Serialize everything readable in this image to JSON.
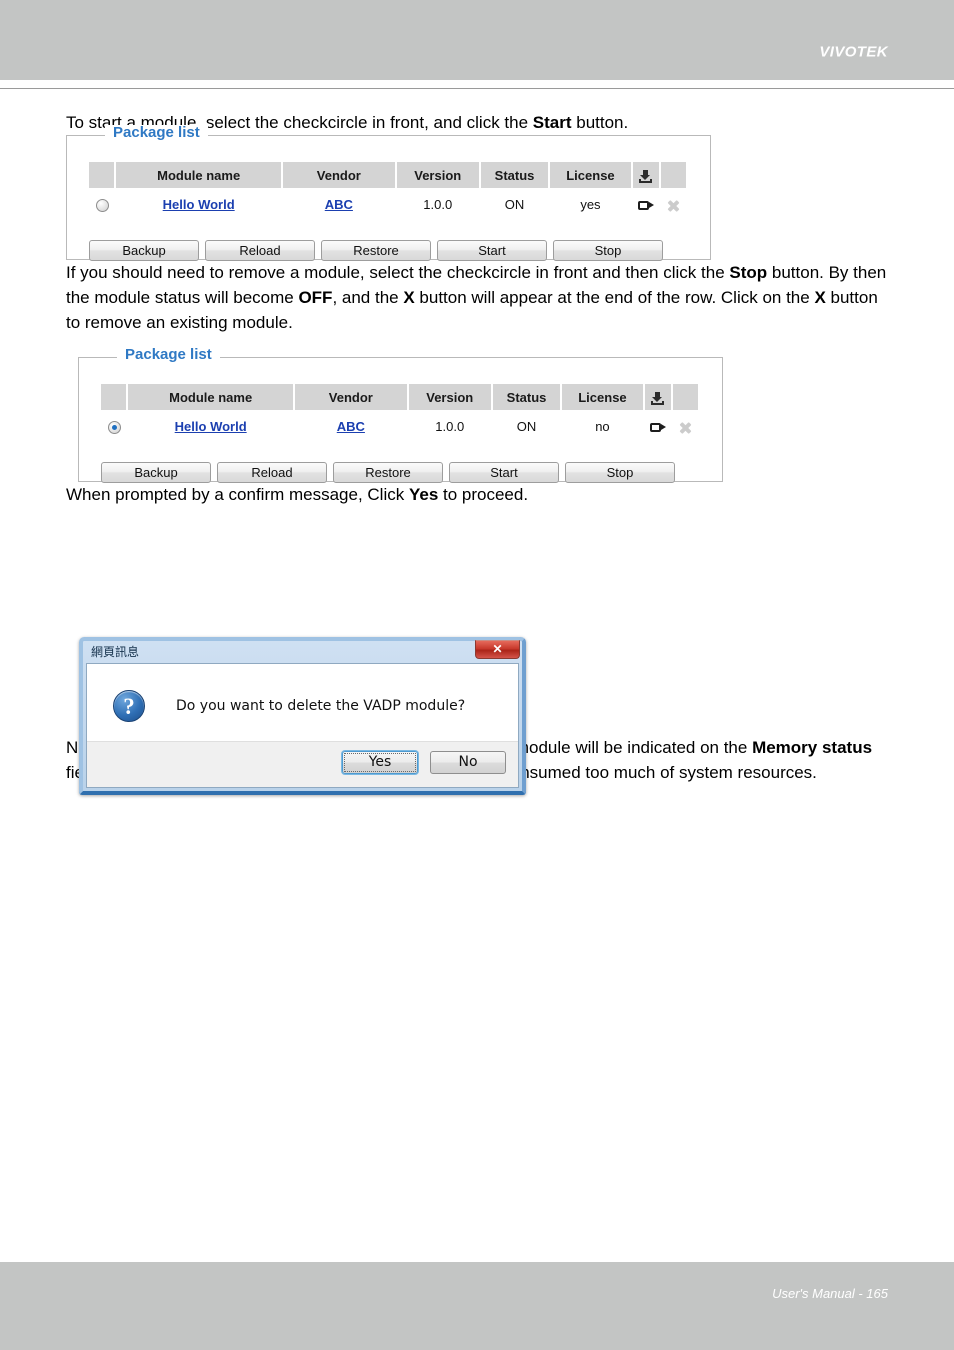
{
  "header": {
    "brand": "VIVOTEK"
  },
  "footer": {
    "text": "User's Manual - 165"
  },
  "paragraphs": {
    "p1_a": "To start a module, select the checkcircle in front, and click the ",
    "p1_b": "Start",
    "p1_c": " button.",
    "p2_a": "If you should need to remove a module, select the checkcircle in front and then click the ",
    "p2_b": "Stop",
    "p2_c": " button. By then the module status will become ",
    "p2_d": "OFF",
    "p2_e": ", and the ",
    "p2_f": "X",
    "p2_g": " button will appear at the end of the row. Click on the ",
    "p2_h": "X",
    "p2_i": " button to remove an existing module.",
    "p3_a": "When prompted by a confirm message, Click ",
    "p3_b": "Yes",
    "p3_c": " to proceed.",
    "p4_a": "Note that the actual memory consumed while operating the module will be indicated on the ",
    "p4_b": "Memory status",
    "p4_c": " field. This helps determine whether a running module has consumed too much of system resources."
  },
  "package_list_1": {
    "legend": "Package list",
    "columns": [
      "",
      "Module name",
      "Vendor",
      "Version",
      "Status",
      "License",
      "download-icon",
      ""
    ],
    "row": {
      "selected": false,
      "module_name": "Hello World",
      "vendor": "ABC",
      "version": "1.0.0",
      "status": "ON",
      "license": "yes"
    },
    "buttons": [
      "Backup",
      "Reload",
      "Restore",
      "Start",
      "Stop"
    ]
  },
  "package_list_2": {
    "legend": "Package list",
    "columns": [
      "",
      "Module name",
      "Vendor",
      "Version",
      "Status",
      "License",
      "download-icon",
      ""
    ],
    "row": {
      "selected": true,
      "module_name": "Hello World",
      "vendor": "ABC",
      "version": "1.0.0",
      "status": "ON",
      "license": "no"
    },
    "buttons": [
      "Backup",
      "Reload",
      "Restore",
      "Start",
      "Stop"
    ]
  },
  "dialog": {
    "title": "網頁訊息",
    "close_label": "✕",
    "message": "Do you want to delete the VADP module?",
    "question_glyph": "?",
    "yes_label": "Yes",
    "no_label": "No"
  },
  "colors": {
    "band": "#c3c5c4",
    "legend_blue": "#2f79c4",
    "link_blue": "#1b3fb0",
    "table_header": "#d4d4d4",
    "dialog_border": "#6f9fd0",
    "close_red": "#c8392c"
  }
}
